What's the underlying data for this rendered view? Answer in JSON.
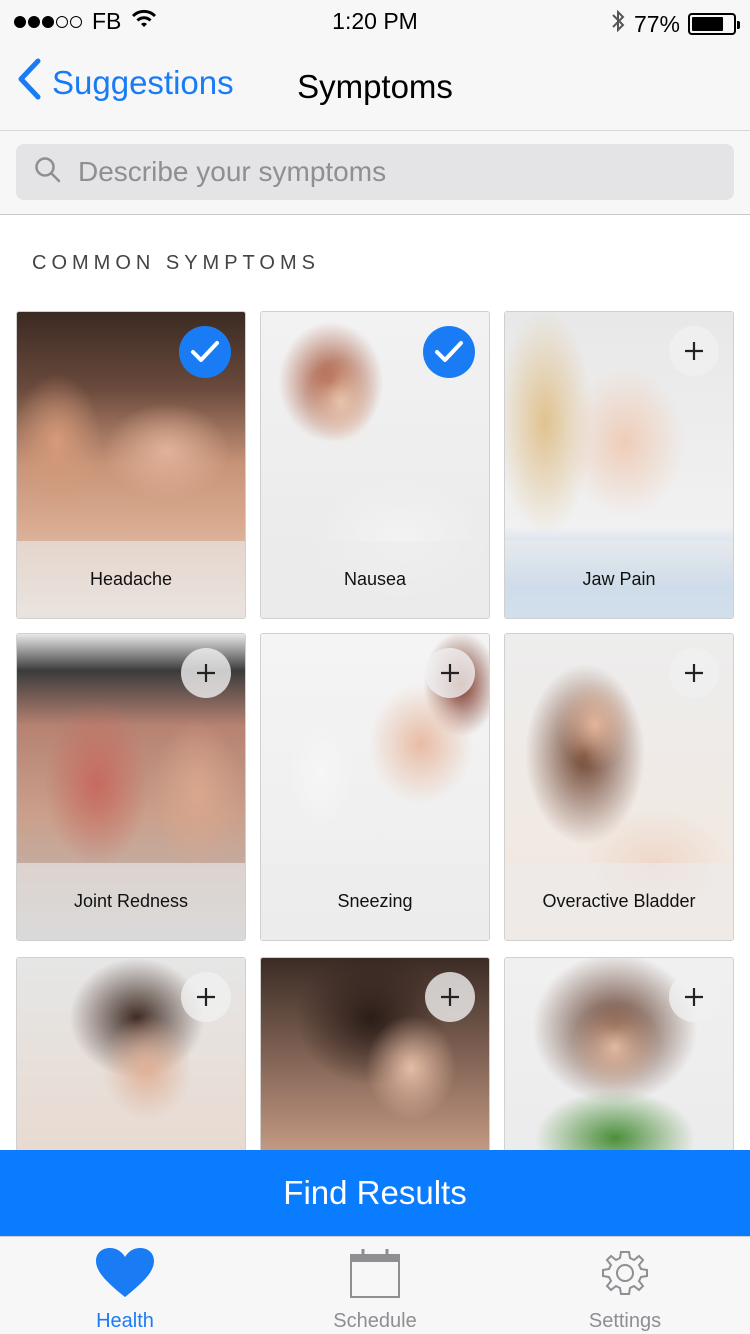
{
  "status_bar": {
    "carrier": "FB",
    "time": "1:20 PM",
    "battery_percent": "77%",
    "battery_level": 0.77,
    "signal_bars_filled": 3,
    "signal_bars_total": 5
  },
  "nav": {
    "back_label": "Suggestions",
    "title": "Symptoms"
  },
  "search": {
    "placeholder": "Describe your symptoms"
  },
  "section": {
    "title": "COMMON SYMPTOMS"
  },
  "symptoms": [
    {
      "label": "Headache",
      "selected": true
    },
    {
      "label": "Nausea",
      "selected": true
    },
    {
      "label": "Jaw Pain",
      "selected": false
    },
    {
      "label": "Joint Redness",
      "selected": false
    },
    {
      "label": "Sneezing",
      "selected": false
    },
    {
      "label": "Overactive Bladder",
      "selected": false
    },
    {
      "label": "",
      "selected": false
    },
    {
      "label": "",
      "selected": false
    },
    {
      "label": "",
      "selected": false
    }
  ],
  "find_button": {
    "label": "Find Results"
  },
  "tabs": [
    {
      "label": "Health",
      "icon": "heart-icon",
      "active": true
    },
    {
      "label": "Schedule",
      "icon": "calendar-icon",
      "active": false
    },
    {
      "label": "Settings",
      "icon": "gear-icon",
      "active": false
    }
  ],
  "colors": {
    "accent": "#1a7cf5",
    "find_button": "#0a7cff"
  }
}
